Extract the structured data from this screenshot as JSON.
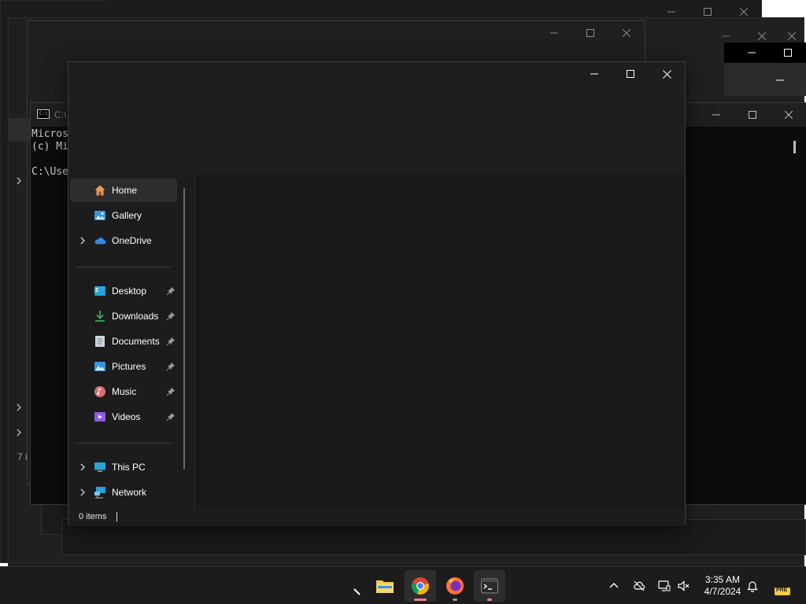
{
  "console": {
    "title": "C:\\",
    "icon_text": "C:\\",
    "lines": [
      "Micros",
      "(c) Mi",
      "",
      "C:\\Use"
    ]
  },
  "left_fragment": {
    "status_text": "7 i"
  },
  "explorer": {
    "nav": {
      "home": "Home",
      "gallery": "Gallery",
      "onedrive": "OneDrive",
      "desktop": "Desktop",
      "downloads": "Downloads",
      "documents": "Documents",
      "pictures": "Pictures",
      "music": "Music",
      "videos": "Videos",
      "this_pc": "This PC",
      "network": "Network"
    },
    "status": {
      "item_count": "0 items"
    }
  },
  "taskbar": {
    "apps": [
      "file-explorer",
      "chrome",
      "firefox",
      "terminal"
    ],
    "active_app": "chrome",
    "clock": {
      "time": "3:35 AM",
      "date": "4/7/2024"
    },
    "badge": "PRE"
  },
  "colors": {
    "window_bg": "#202020",
    "taskbar_bg": "#1c1c1c",
    "selected_bg": "#2d2d2d",
    "accent_blue": "#3a96dd"
  }
}
